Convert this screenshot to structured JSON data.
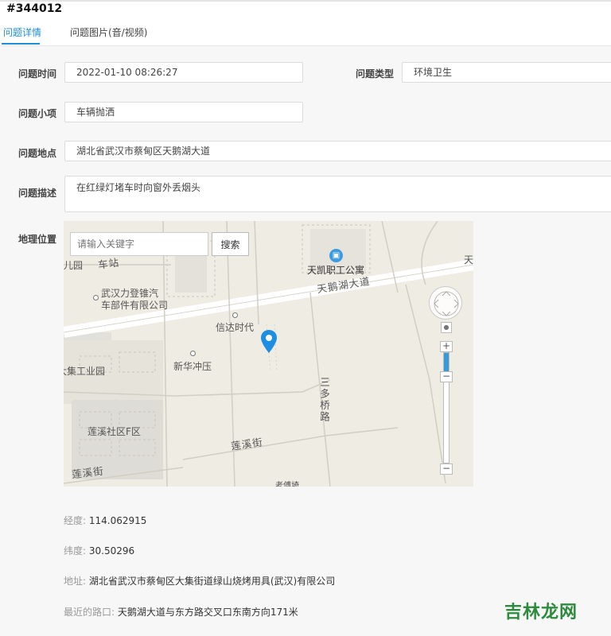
{
  "header": {
    "ticket_id": "#344012",
    "tabs": [
      {
        "label": "问题详情"
      },
      {
        "label": "问题图片(音/视频)"
      }
    ]
  },
  "form": {
    "time": {
      "label": "问题时间",
      "value": "2022-01-10 08:26:27"
    },
    "type": {
      "label": "问题类型",
      "value": "环境卫生"
    },
    "item": {
      "label": "问题小项",
      "value": "车辆抛洒"
    },
    "location": {
      "label": "问题地点",
      "value": "湖北省武汉市蔡甸区天鹅湖大道"
    },
    "description": {
      "label": "问题描述",
      "value": "在红绿灯堵车时向窗外丢烟头"
    },
    "geo_label": "地理位置"
  },
  "map": {
    "search_placeholder": "请输入关键字",
    "search_button": "搜索",
    "labels": {
      "station": "车站",
      "yuan": "儿园",
      "company": "武汉力登锥汽",
      "company2": "车部件有限公司",
      "xinda": "信达时代",
      "xinhua": "新华冲压",
      "industrial": "大集工业园",
      "lianxi_area": "莲溪社区F区",
      "lianxi_street": "莲溪街",
      "lianxi_street2": "莲溪街",
      "sanduo": "三多桥路",
      "apartment": "天凯职工公寓",
      "tiane_road": "天鹅湖大道",
      "tian_edge": "天",
      "laopu": "老傅埼"
    },
    "icons": {
      "pin": "location-pin-icon",
      "apartment": "building-icon"
    },
    "pin_color": "#1e8fe0",
    "zoom_level": 0.2
  },
  "info": {
    "longitude": {
      "label": "经度:",
      "value": "114.062915"
    },
    "latitude": {
      "label": "纬度:",
      "value": "30.50296"
    },
    "address": {
      "label": "地址:",
      "value": "湖北省武汉市蔡甸区大集街道绿山烧烤用具(武汉)有限公司"
    },
    "intersection": {
      "label": "最近的路口:",
      "value": "天鹅湖大道与东方路交叉口东南方向171米"
    }
  },
  "watermark": "吉林龙网"
}
